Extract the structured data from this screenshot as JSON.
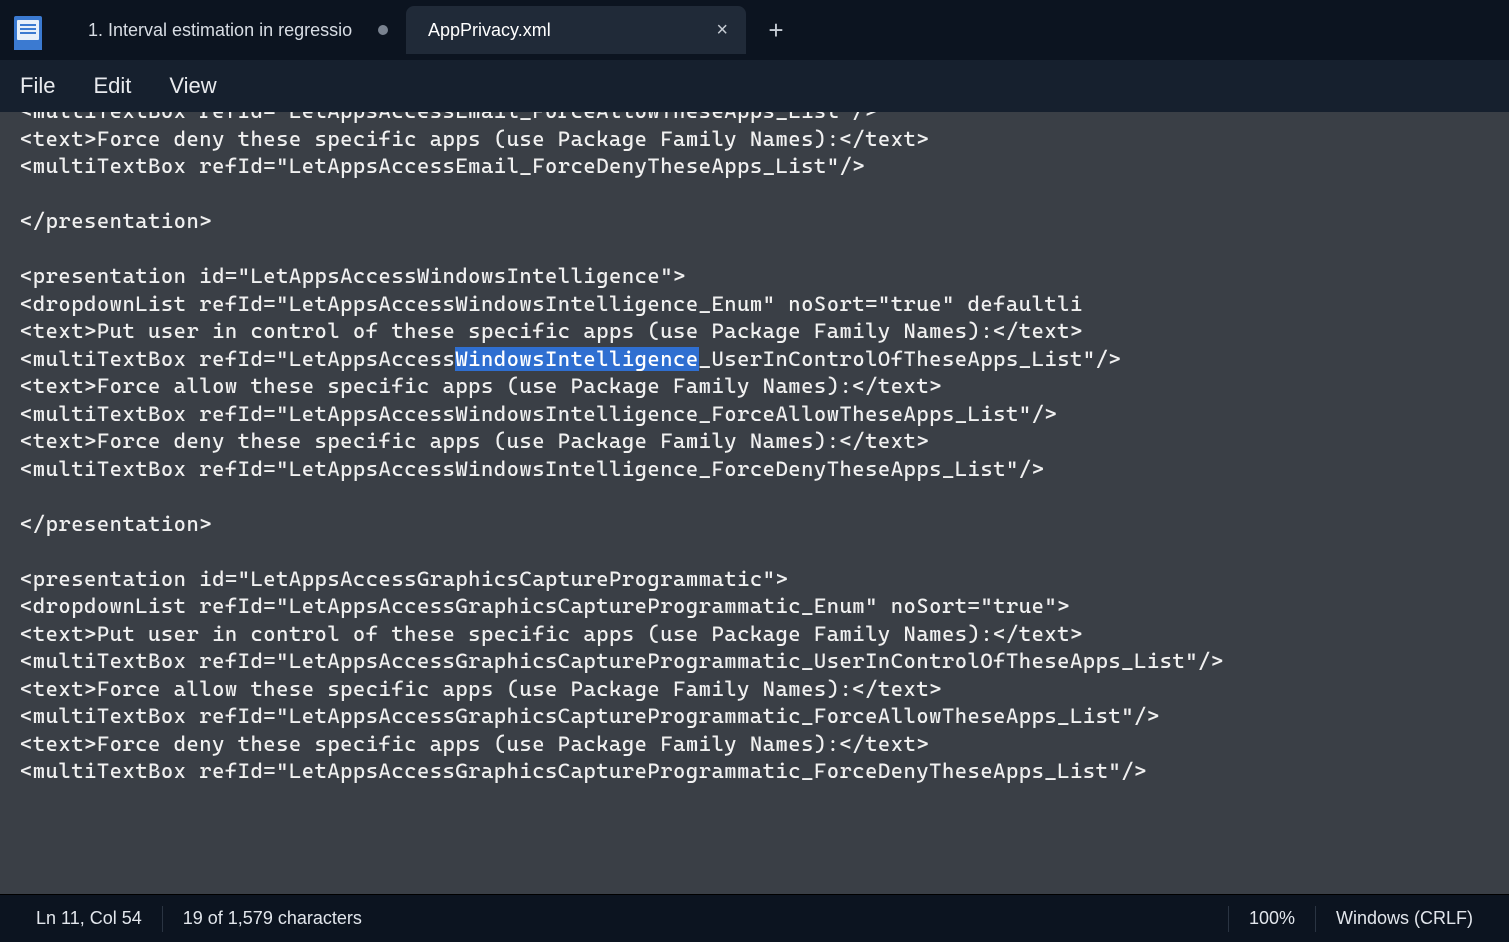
{
  "tabs": [
    {
      "title": "1. Interval estimation in regressio",
      "dirty": true,
      "active": false
    },
    {
      "title": "AppPrivacy.xml",
      "dirty": false,
      "active": true
    }
  ],
  "menu": {
    "file": "File",
    "edit": "Edit",
    "view": "View"
  },
  "editor": {
    "lines": [
      "<multiTextBox refId=\"LetAppsAccessEmail_ForceAllowTheseApps_List\"/>",
      "<text>Force deny these specific apps (use Package Family Names):</text>",
      "<multiTextBox refId=\"LetAppsAccessEmail_ForceDenyTheseApps_List\"/>",
      "",
      "</presentation>",
      "",
      "<presentation id=\"LetAppsAccessWindowsIntelligence\">",
      "<dropdownList refId=\"LetAppsAccessWindowsIntelligence_Enum\" noSort=\"true\" defaultli",
      "<text>Put user in control of these specific apps (use Package Family Names):</text>",
      "<multiTextBox refId=\"LetAppsAccessWindowsIntelligence_UserInControlOfTheseApps_List\"/>",
      "<text>Force allow these specific apps (use Package Family Names):</text>",
      "<multiTextBox refId=\"LetAppsAccessWindowsIntelligence_ForceAllowTheseApps_List\"/>",
      "<text>Force deny these specific apps (use Package Family Names):</text>",
      "<multiTextBox refId=\"LetAppsAccessWindowsIntelligence_ForceDenyTheseApps_List\"/>",
      "",
      "</presentation>",
      "",
      "<presentation id=\"LetAppsAccessGraphicsCaptureProgrammatic\">",
      "<dropdownList refId=\"LetAppsAccessGraphicsCaptureProgrammatic_Enum\" noSort=\"true\">",
      "<text>Put user in control of these specific apps (use Package Family Names):</text>",
      "<multiTextBox refId=\"LetAppsAccessGraphicsCaptureProgrammatic_UserInControlOfTheseApps_List\"/>",
      "<text>Force allow these specific apps (use Package Family Names):</text>",
      "<multiTextBox refId=\"LetAppsAccessGraphicsCaptureProgrammatic_ForceAllowTheseApps_List\"/>",
      "<text>Force deny these specific apps (use Package Family Names):</text>",
      "<multiTextBox refId=\"LetAppsAccessGraphicsCaptureProgrammatic_ForceDenyTheseApps_List\"/>"
    ],
    "selection": {
      "lineIndex": 9,
      "text": "WindowsIntelligence"
    }
  },
  "status": {
    "position": "Ln 11, Col 54",
    "chars": "19 of 1,579 characters",
    "zoom": "100%",
    "encoding": "Windows (CRLF)"
  }
}
